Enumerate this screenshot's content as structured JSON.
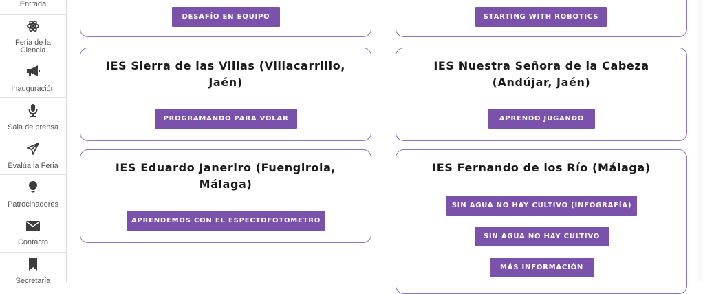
{
  "sidebar": {
    "items": [
      {
        "label": "Entrada",
        "icon": "entrance-icon"
      },
      {
        "label": "Feria de la Ciencia",
        "icon": "atom-icon"
      },
      {
        "label": "Inauguración",
        "icon": "megaphone-icon"
      },
      {
        "label": "Sala de prensa",
        "icon": "microphone-icon"
      },
      {
        "label": "Evalúa la Feria",
        "icon": "paper-plane-icon"
      },
      {
        "label": "Patrocinadores",
        "icon": "lightbulb-icon"
      },
      {
        "label": "Contacto",
        "icon": "envelope-icon"
      },
      {
        "label": "Secretaría",
        "icon": "bookmark-icon"
      }
    ]
  },
  "cards": [
    {
      "title": "",
      "buttons": [
        "DESAFÍO EN EQUIPO"
      ]
    },
    {
      "title": "",
      "buttons": [
        "STARTING WITH ROBOTICS"
      ]
    },
    {
      "title_lines": [
        "IES Sierra de las Villas (Villacarrillo,",
        "Jaén)"
      ],
      "buttons": [
        "PROGRAMANDO PARA VOLAR"
      ]
    },
    {
      "title_lines": [
        "IES Nuestra Señora de la Cabeza",
        "(Andújar, Jaén)"
      ],
      "buttons": [
        "APRENDO JUGANDO"
      ]
    },
    {
      "title_lines": [
        "IES Eduardo Janeriro (Fuengirola,",
        "Málaga)"
      ],
      "buttons": [
        "APRENDEMOS CON EL ESPECTOFOTOMETRO"
      ]
    },
    {
      "title_lines": [
        "IES Fernando de los Río (Málaga)"
      ],
      "buttons": [
        "SIN AGUA NO HAY CULTIVO (INFOGRAFÍA)",
        "SIN AGUA NO HAY CULTIVO",
        "MÁS INFORMACIÓN"
      ]
    }
  ],
  "colors": {
    "accent": "#7b52ab",
    "card_border": "#8c74bf",
    "sidebar_icon": "#3d3d3d"
  }
}
